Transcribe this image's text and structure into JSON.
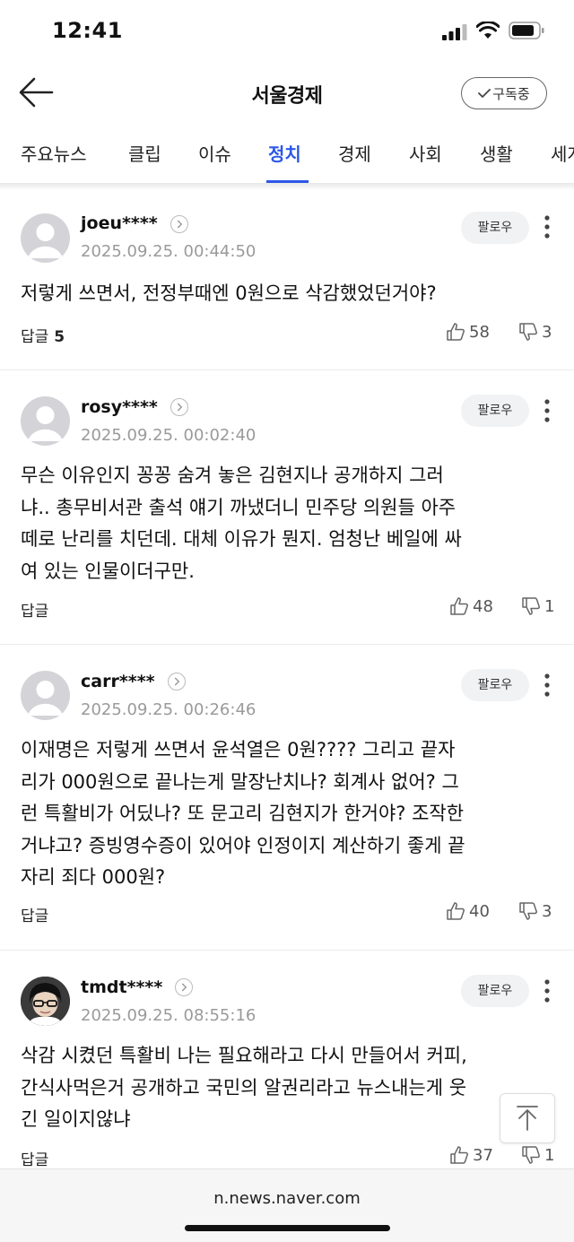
{
  "status_bar": {
    "time": "12:41"
  },
  "header": {
    "title": "서울경제",
    "subscribe_label": "구독중"
  },
  "tabs": [
    {
      "label": "주요뉴스"
    },
    {
      "label": "클립"
    },
    {
      "label": "이슈"
    },
    {
      "label": "정치",
      "active": true
    },
    {
      "label": "경제"
    },
    {
      "label": "사회"
    },
    {
      "label": "생활"
    },
    {
      "label": "세계"
    }
  ],
  "colors": {
    "accent": "#2d57e6"
  },
  "comments": [
    {
      "username": "joeu****",
      "timestamp": "2025.09.25. 00:44:50",
      "follow_label": "팔로우",
      "lines": [
        "저렇게 쓰면서, 전정부때엔 0원으로 삭감했었던거야?"
      ],
      "reply_label": "답글",
      "reply_count": "5",
      "likes": "58",
      "dislikes": "3"
    },
    {
      "username": "rosy****",
      "timestamp": "2025.09.25. 00:02:40",
      "follow_label": "팔로우",
      "lines": [
        "무슨 이유인지 꽁꽁 숨겨 놓은 김현지나 공개하지 그러",
        "냐.. 총무비서관 출석 얘기 까냈더니 민주당 의원들 아주",
        "떼로 난리를 치던데. 대체 이유가 뭔지. 엄청난 베일에 싸",
        "여 있는 인물이더구만."
      ],
      "reply_label": "답글",
      "reply_count": "",
      "likes": "48",
      "dislikes": "1"
    },
    {
      "username": "carr****",
      "timestamp": "2025.09.25. 00:26:46",
      "follow_label": "팔로우",
      "lines": [
        "이재명은 저렇게 쓰면서 윤석열은 0원???? 그리고 끝자",
        "리가 000원으로 끝나는게 말장난치나? 회계사 없어? 그",
        "런 특활비가 어딨나? 또 문고리 김현지가 한거야? 조작한",
        "거냐고? 증빙영수증이 있어야 인정이지 계산하기 좋게 끝",
        "자리 죄다 000원?"
      ],
      "reply_label": "답글",
      "reply_count": "",
      "likes": "40",
      "dislikes": "3"
    },
    {
      "username": "tmdt****",
      "timestamp": "2025.09.25. 08:55:16",
      "follow_label": "팔로우",
      "lines": [
        "삭감 시켰던 특활비 나는 필요해라고 다시 만들어서 커피,",
        "간식사먹은거 공개하고 국민의 알권리라고 뉴스내는게 웃",
        "긴 일이지않냐"
      ],
      "reply_label": "답글",
      "reply_count": "",
      "likes": "37",
      "dislikes": "1"
    }
  ],
  "bottom_bar": {
    "url": "n.news.naver.com"
  }
}
